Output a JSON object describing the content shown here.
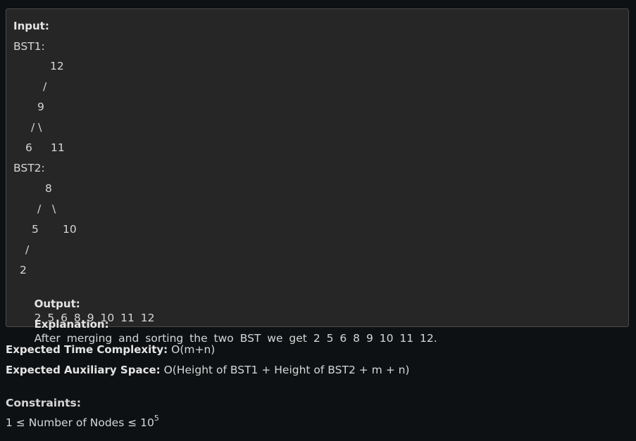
{
  "example": {
    "input_label": "Input:",
    "bst1_label": "BST1:",
    "bst1_row1": "12",
    "bst1_row2": "/",
    "bst1_row3": "9",
    "bst1_row4": "/ \\",
    "bst1_row5_left": "6",
    "bst1_row5_right": "11",
    "bst2_label": "BST2:",
    "bst2_row1": "8",
    "bst2_row2_left": "/",
    "bst2_row2_right": "\\",
    "bst2_row3_left": "5",
    "bst2_row3_right": "10",
    "bst2_row4": "/",
    "bst2_row5": "2",
    "output_label": "Output:",
    "output_value": "2 5 6 8 9 10 11 12",
    "explanation_label": "Explanation:",
    "explanation_value": "After merging and sorting the two BST we get 2 5 6 8 9 10 11 12."
  },
  "complexity": {
    "time_label": "Expected Time Complexity:",
    "time_value": "O(m+n)",
    "space_label": "Expected Auxiliary Space:",
    "space_value": "O(Height of BST1 + Height of BST2 + m + n)"
  },
  "constraints": {
    "label": "Constraints:",
    "text": "1 ≤ Number of Nodes ≤ 10",
    "exponent": "5"
  }
}
